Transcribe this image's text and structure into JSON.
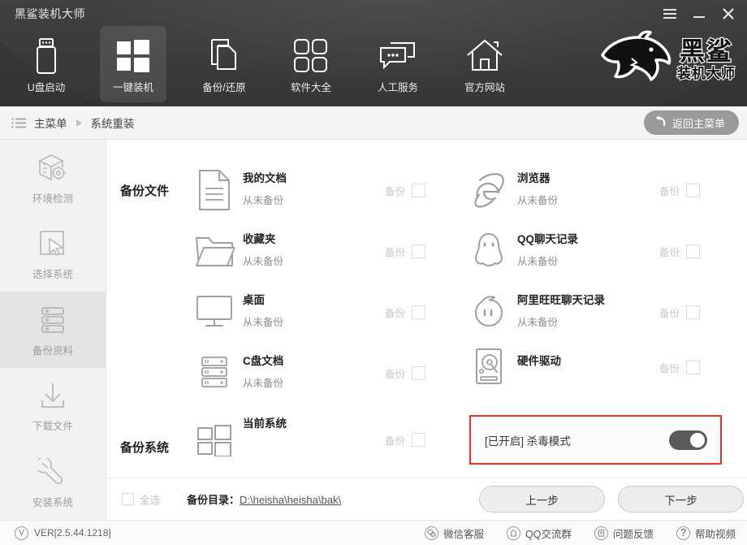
{
  "window": {
    "title": "黑鲨装机大师",
    "controls": [
      {
        "name": "menu",
        "glyph": "menu-icon"
      },
      {
        "name": "minimize",
        "glyph": "minimize-icon"
      },
      {
        "name": "close",
        "glyph": "close-icon"
      }
    ]
  },
  "nav": {
    "items": [
      {
        "id": "usb",
        "label": "U盘启动",
        "icon": "usb-drive-icon",
        "active": false
      },
      {
        "id": "oneclick",
        "label": "一键装机",
        "icon": "windows-logo-icon",
        "active": true
      },
      {
        "id": "backup",
        "label": "备份/还原",
        "icon": "copy-pages-icon",
        "active": false
      },
      {
        "id": "software",
        "label": "软件大全",
        "icon": "four-squares-icon",
        "active": false
      },
      {
        "id": "service",
        "label": "人工服务",
        "icon": "chat-bubbles-icon",
        "active": false
      },
      {
        "id": "website",
        "label": "官方网站",
        "icon": "home-icon",
        "active": false
      }
    ]
  },
  "brand": {
    "main": "黑鲨",
    "sub": "装机大师",
    "logo": "shark-logo-icon"
  },
  "breadcrumb": {
    "menu_icon": "list-menu-icon",
    "root": "主菜单",
    "separator": "▶",
    "current": "系统重装",
    "back_button": "返回主菜单",
    "back_icon": "undo-arrow-icon"
  },
  "sidebar": {
    "items": [
      {
        "id": "env-check",
        "label": "环境检测",
        "icon": "box-gear-icon",
        "active": false
      },
      {
        "id": "select-sys",
        "label": "选择系统",
        "icon": "cursor-select-icon",
        "active": false
      },
      {
        "id": "backup-data",
        "label": "备份资料",
        "icon": "server-stack-icon",
        "active": true
      },
      {
        "id": "download",
        "label": "下载文件",
        "icon": "download-icon",
        "active": false
      },
      {
        "id": "install",
        "label": "安装系统",
        "icon": "wrench-icon",
        "active": false
      }
    ]
  },
  "main": {
    "sections": {
      "files_title": "备份文件",
      "system_title": "备份系统"
    },
    "checkbox_label": "备份",
    "file_items": [
      {
        "name": "我的文档",
        "status": "从未备份",
        "icon": "document-icon",
        "checked": false,
        "col": 0,
        "row": 0
      },
      {
        "name": "浏览器",
        "status": "从未备份",
        "icon": "ie-browser-icon",
        "checked": false,
        "col": 1,
        "row": 0
      },
      {
        "name": "收藏夹",
        "status": "从未备份",
        "icon": "folder-icon",
        "checked": false,
        "col": 0,
        "row": 1
      },
      {
        "name": "QQ聊天记录",
        "status": "从未备份",
        "icon": "qq-penguin-icon",
        "checked": false,
        "col": 1,
        "row": 1
      },
      {
        "name": "桌面",
        "status": "从未备份",
        "icon": "monitor-icon",
        "checked": false,
        "col": 0,
        "row": 2
      },
      {
        "name": "阿里旺旺聊天记录",
        "status": "从未备份",
        "icon": "aliwangwang-icon",
        "checked": false,
        "col": 1,
        "row": 2
      },
      {
        "name": "C盘文档",
        "status": "从未备份",
        "icon": "server-stack-icon",
        "checked": false,
        "col": 0,
        "row": 3
      },
      {
        "name": "硬件驱动",
        "status": "",
        "icon": "hard-disk-icon",
        "checked": false,
        "col": 1,
        "row": 3
      }
    ],
    "system_item": {
      "name": "当前系统",
      "status": "",
      "icon": "windows-logo-icon",
      "checked": false
    },
    "antivirus": {
      "label": "[已开启] 杀毒模式",
      "enabled": true,
      "highlight_color": "#ee3124",
      "toggle_color": "#5a5a5a"
    },
    "select_all": {
      "label": "全选",
      "checked": false
    },
    "backup_dir": {
      "label": "备份目录：",
      "path": "D:\\heisha\\heisha\\bak\\"
    },
    "buttons": {
      "prev": "上一步",
      "next": "下一步"
    }
  },
  "footer": {
    "version": "VER[2.5.44.1218]",
    "version_icon": "v-circle-icon",
    "links": [
      {
        "label": "微信客服",
        "icon": "wechat-icon",
        "glyph": "❀"
      },
      {
        "label": "QQ交流群",
        "icon": "qq-group-icon",
        "glyph": "◠"
      },
      {
        "label": "问题反馈",
        "icon": "feedback-icon",
        "glyph": "✎"
      },
      {
        "label": "帮助视频",
        "icon": "help-icon",
        "glyph": "?"
      }
    ]
  }
}
